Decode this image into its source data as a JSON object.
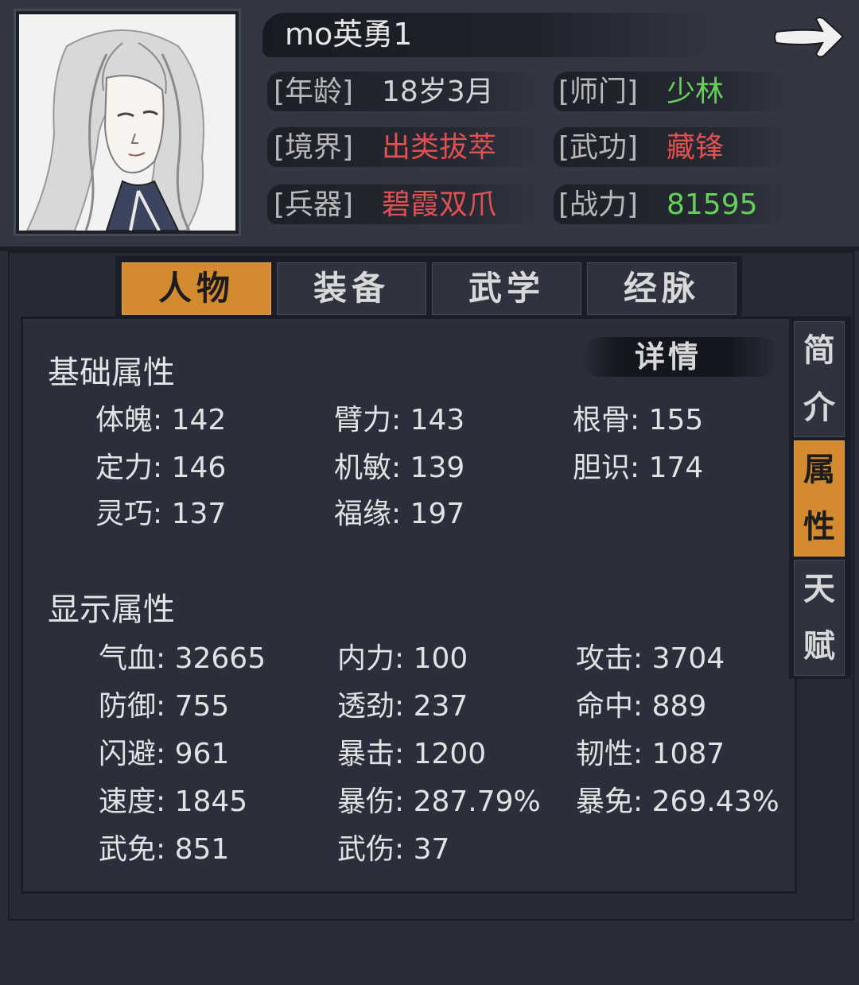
{
  "player": {
    "name": "mo英勇1"
  },
  "info": [
    {
      "label": "[年龄]",
      "value": "18岁3月",
      "color": "#d4d4d4"
    },
    {
      "label": "[师门]",
      "value": "少林",
      "color": "#65d15a"
    },
    {
      "label": "[境界]",
      "value": "出类拔萃",
      "color": "#e05050"
    },
    {
      "label": "[武功]",
      "value": "藏锋",
      "color": "#e05050"
    },
    {
      "label": "[兵器]",
      "value": "碧霞双爪",
      "color": "#e05050"
    },
    {
      "label": "[战力]",
      "value": "81595",
      "color": "#65d15a"
    }
  ],
  "tabs": [
    {
      "label": "人物",
      "active": true
    },
    {
      "label": "装备",
      "active": false
    },
    {
      "label": "武学",
      "active": false
    },
    {
      "label": "经脉",
      "active": false
    }
  ],
  "side_tabs": [
    {
      "chars": [
        "简",
        "介"
      ],
      "active": false
    },
    {
      "chars": [
        "属",
        "性"
      ],
      "active": true
    },
    {
      "chars": [
        "天",
        "赋"
      ],
      "active": false
    }
  ],
  "detail_label": "详情",
  "basic": {
    "title": "基础属性",
    "stats": [
      "体魄: 142",
      "臂力: 143",
      "根骨: 155",
      "定力: 146",
      "机敏: 139",
      "胆识: 174",
      "灵巧: 137",
      "福缘: 197"
    ]
  },
  "display": {
    "title": "显示属性",
    "stats": [
      "气血: 32665",
      "内力: 100",
      "攻击: 3704",
      "防御: 755",
      "透劲: 237",
      "命中: 889",
      "闪避: 961",
      "暴击: 1200",
      "韧性: 1087",
      "速度: 1845",
      "暴伤: 287.79%",
      "暴免: 269.43%",
      "武免: 851",
      "武伤: 37"
    ]
  },
  "colors": {
    "accent": "#d48a2e",
    "green": "#65d15a",
    "red": "#e05050"
  }
}
